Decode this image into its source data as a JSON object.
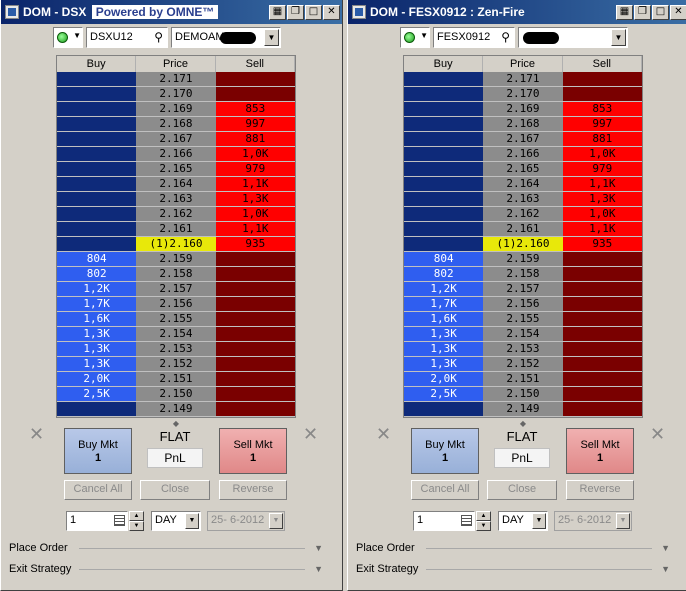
{
  "windows": [
    {
      "title_prefix": "DOM - DSX",
      "title_extra": "Powered by OMNE™",
      "symbol": "DSXU12",
      "account": "DEMOAMP",
      "header": {
        "buy": "Buy",
        "price": "Price",
        "sell": "Sell"
      },
      "inside_price": "(1)2.160",
      "rows": [
        {
          "buy": "",
          "price": "2.171",
          "sell": "",
          "zone": "ask"
        },
        {
          "buy": "",
          "price": "2.170",
          "sell": "",
          "zone": "ask"
        },
        {
          "buy": "",
          "price": "2.169",
          "sell": "853",
          "zone": "ask"
        },
        {
          "buy": "",
          "price": "2.168",
          "sell": "997",
          "zone": "ask"
        },
        {
          "buy": "",
          "price": "2.167",
          "sell": "881",
          "zone": "ask"
        },
        {
          "buy": "",
          "price": "2.166",
          "sell": "1,0K",
          "zone": "ask"
        },
        {
          "buy": "",
          "price": "2.165",
          "sell": "979",
          "zone": "ask"
        },
        {
          "buy": "",
          "price": "2.164",
          "sell": "1,1K",
          "zone": "ask"
        },
        {
          "buy": "",
          "price": "2.163",
          "sell": "1,3K",
          "zone": "ask"
        },
        {
          "buy": "",
          "price": "2.162",
          "sell": "1,0K",
          "zone": "ask"
        },
        {
          "buy": "",
          "price": "2.161",
          "sell": "1,1K",
          "zone": "ask"
        },
        {
          "buy": "",
          "price": "(1)2.160",
          "sell": "935",
          "zone": "inside"
        },
        {
          "buy": "804",
          "price": "2.159",
          "sell": "",
          "zone": "bid"
        },
        {
          "buy": "802",
          "price": "2.158",
          "sell": "",
          "zone": "bid"
        },
        {
          "buy": "1,2K",
          "price": "2.157",
          "sell": "",
          "zone": "bid"
        },
        {
          "buy": "1,7K",
          "price": "2.156",
          "sell": "",
          "zone": "bid"
        },
        {
          "buy": "1,6K",
          "price": "2.155",
          "sell": "",
          "zone": "bid"
        },
        {
          "buy": "1,3K",
          "price": "2.154",
          "sell": "",
          "zone": "bid"
        },
        {
          "buy": "1,3K",
          "price": "2.153",
          "sell": "",
          "zone": "bid"
        },
        {
          "buy": "1,3K",
          "price": "2.152",
          "sell": "",
          "zone": "bid"
        },
        {
          "buy": "2,0K",
          "price": "2.151",
          "sell": "",
          "zone": "bid"
        },
        {
          "buy": "2,5K",
          "price": "2.150",
          "sell": "",
          "zone": "bid"
        },
        {
          "buy": "",
          "price": "2.149",
          "sell": "",
          "zone": "bid"
        }
      ]
    },
    {
      "title_prefix": "DOM - FESX0912 : Zen-Fire",
      "title_extra": "",
      "symbol": "FESX0912",
      "account": "",
      "header": {
        "buy": "Buy",
        "price": "Price",
        "sell": "Sell"
      },
      "inside_price": "(1)2.160",
      "rows": [
        {
          "buy": "",
          "price": "2.171",
          "sell": "",
          "zone": "ask"
        },
        {
          "buy": "",
          "price": "2.170",
          "sell": "",
          "zone": "ask"
        },
        {
          "buy": "",
          "price": "2.169",
          "sell": "853",
          "zone": "ask"
        },
        {
          "buy": "",
          "price": "2.168",
          "sell": "997",
          "zone": "ask"
        },
        {
          "buy": "",
          "price": "2.167",
          "sell": "881",
          "zone": "ask"
        },
        {
          "buy": "",
          "price": "2.166",
          "sell": "1,0K",
          "zone": "ask"
        },
        {
          "buy": "",
          "price": "2.165",
          "sell": "979",
          "zone": "ask"
        },
        {
          "buy": "",
          "price": "2.164",
          "sell": "1,1K",
          "zone": "ask"
        },
        {
          "buy": "",
          "price": "2.163",
          "sell": "1,3K",
          "zone": "ask"
        },
        {
          "buy": "",
          "price": "2.162",
          "sell": "1,0K",
          "zone": "ask"
        },
        {
          "buy": "",
          "price": "2.161",
          "sell": "1,1K",
          "zone": "ask"
        },
        {
          "buy": "",
          "price": "(1)2.160",
          "sell": "935",
          "zone": "inside"
        },
        {
          "buy": "804",
          "price": "2.159",
          "sell": "",
          "zone": "bid"
        },
        {
          "buy": "802",
          "price": "2.158",
          "sell": "",
          "zone": "bid"
        },
        {
          "buy": "1,2K",
          "price": "2.157",
          "sell": "",
          "zone": "bid"
        },
        {
          "buy": "1,7K",
          "price": "2.156",
          "sell": "",
          "zone": "bid"
        },
        {
          "buy": "1,6K",
          "price": "2.155",
          "sell": "",
          "zone": "bid"
        },
        {
          "buy": "1,3K",
          "price": "2.154",
          "sell": "",
          "zone": "bid"
        },
        {
          "buy": "1,3K",
          "price": "2.153",
          "sell": "",
          "zone": "bid"
        },
        {
          "buy": "1,3K",
          "price": "2.152",
          "sell": "",
          "zone": "bid"
        },
        {
          "buy": "2,0K",
          "price": "2.151",
          "sell": "",
          "zone": "bid"
        },
        {
          "buy": "2,5K",
          "price": "2.150",
          "sell": "",
          "zone": "bid"
        },
        {
          "buy": "",
          "price": "2.149",
          "sell": "",
          "zone": "bid"
        }
      ]
    }
  ],
  "controls": {
    "buy_mkt": "Buy Mkt",
    "sell_mkt": "Sell Mkt",
    "order_qty": "1",
    "flat": "FLAT",
    "pnl": "PnL",
    "cancel_all": "Cancel All",
    "close": "Close",
    "reverse": "Reverse",
    "qty_value": "1",
    "tif_value": "DAY",
    "date_value": "25- 6-2012",
    "place_order": "Place Order",
    "exit_strategy": "Exit Strategy"
  },
  "colors": {
    "buy_empty": "#0e2a7a",
    "buy_full": "#2f5ef0",
    "price": "#8c8c8c",
    "price_inside": "#e8e80a",
    "sell_empty": "#7a0000",
    "sell_full": "#ff0000"
  }
}
